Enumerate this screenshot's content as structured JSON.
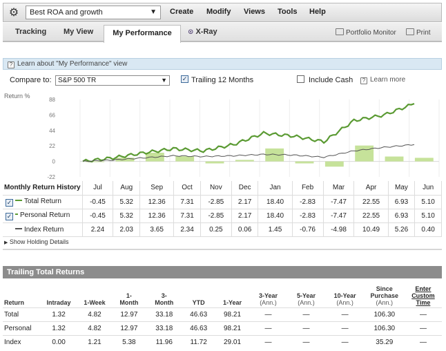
{
  "menu": {
    "portfolio": "Best ROA and growth",
    "items": [
      "Create",
      "Modify",
      "Views",
      "Tools",
      "Help"
    ]
  },
  "tabs": {
    "tracking": "Tracking",
    "my_view": "My View",
    "my_performance": "My Performance",
    "xray": "X-Ray",
    "portfolio_monitor": "Portfolio Monitor",
    "print": "Print"
  },
  "info": {
    "learn": "Learn about \"My Performance\" view"
  },
  "compare": {
    "label": "Compare to:",
    "value": "S&P 500 TR",
    "trailing_label": "Trailing 12 Months",
    "trailing_checked": true,
    "cash_label": "Include Cash",
    "cash_checked": false,
    "learn_more": "Learn more"
  },
  "chart_data": {
    "type": "line",
    "ylabel": "Return %",
    "yticks": [
      88,
      66,
      44,
      22,
      0,
      -22
    ],
    "ylim": [
      -22,
      88
    ],
    "categories": [
      "Jul",
      "Aug",
      "Sep",
      "Oct",
      "Nov",
      "Dec",
      "Jan",
      "Feb",
      "Mar",
      "Apr",
      "May",
      "Jun"
    ],
    "series": [
      {
        "name": "Total Return",
        "color": "#5a9a32",
        "values": [
          0,
          5,
          12,
          18,
          15,
          24,
          40,
          36,
          28,
          58,
          66,
          82
        ]
      },
      {
        "name": "Index Return",
        "color": "#555555",
        "values": [
          0,
          2,
          5,
          8,
          7,
          8,
          10,
          9,
          6,
          15,
          20,
          24
        ]
      }
    ],
    "bars": [
      -0.45,
      5.32,
      12.36,
      7.31,
      -2.85,
      2.17,
      18.4,
      -2.83,
      -7.47,
      22.55,
      6.93,
      5.1
    ],
    "bar_color": "#c6e29a"
  },
  "monthly": {
    "title": "Monthly Return History",
    "months": [
      "Jul",
      "Aug",
      "Sep",
      "Oct",
      "Nov",
      "Dec",
      "Jan",
      "Feb",
      "Mar",
      "Apr",
      "May",
      "Jun"
    ],
    "rows": [
      {
        "label": "Total Return",
        "color": "#5a9a32",
        "checkbox": true,
        "values": [
          "-0.45",
          "5.32",
          "12.36",
          "7.31",
          "-2.85",
          "2.17",
          "18.40",
          "-2.83",
          "-7.47",
          "22.55",
          "6.93",
          "5.10"
        ]
      },
      {
        "label": "Personal Return",
        "color": "#5a9a32",
        "checkbox": true,
        "values": [
          "-0.45",
          "5.32",
          "12.36",
          "7.31",
          "-2.85",
          "2.17",
          "18.40",
          "-2.83",
          "-7.47",
          "22.55",
          "6.93",
          "5.10"
        ]
      },
      {
        "label": "Index Return",
        "color": "#555555",
        "checkbox": false,
        "values": [
          "2.24",
          "2.03",
          "3.65",
          "2.34",
          "0.25",
          "0.06",
          "1.45",
          "-0.76",
          "-4.98",
          "10.49",
          "5.26",
          "0.40"
        ]
      }
    ]
  },
  "holding": "Show Holding Details",
  "trailing": {
    "title": "Trailing Total Returns",
    "headers": [
      {
        "l1": "Return",
        "l2": ""
      },
      {
        "l1": "Intraday",
        "l2": ""
      },
      {
        "l1": "1-Week",
        "l2": ""
      },
      {
        "l1": "1-",
        "l2": "Month"
      },
      {
        "l1": "3-",
        "l2": "Month"
      },
      {
        "l1": "YTD",
        "l2": ""
      },
      {
        "l1": "1-Year",
        "l2": ""
      },
      {
        "l1": "3-Year",
        "l2": "(Ann.)"
      },
      {
        "l1": "5-Year",
        "l2": "(Ann.)"
      },
      {
        "l1": "10-Year",
        "l2": "(Ann.)"
      },
      {
        "l1": "Since Purchase",
        "l2": "(Ann.)"
      },
      {
        "l1": "Enter Custom Time",
        "l2": ""
      }
    ],
    "rows": [
      [
        "Total",
        "1.32",
        "4.82",
        "12.97",
        "33.18",
        "46.63",
        "98.21",
        "—",
        "—",
        "—",
        "106.30",
        "—"
      ],
      [
        "Personal",
        "1.32",
        "4.82",
        "12.97",
        "33.18",
        "46.63",
        "98.21",
        "—",
        "—",
        "—",
        "106.30",
        "—"
      ],
      [
        "Index",
        "0.00",
        "1.21",
        "5.38",
        "11.96",
        "11.72",
        "29.01",
        "—",
        "—",
        "—",
        "35.29",
        "—"
      ]
    ]
  }
}
